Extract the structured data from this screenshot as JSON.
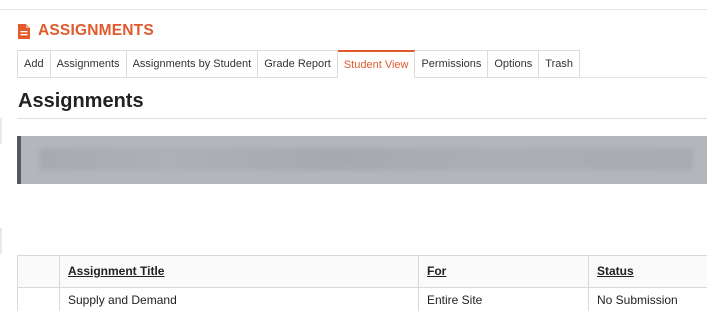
{
  "tool": {
    "title": "ASSIGNMENTS",
    "accent_color": "#e05a2b",
    "icon": "document-icon"
  },
  "nav": {
    "items": [
      {
        "label": "Add"
      },
      {
        "label": "Assignments"
      },
      {
        "label": "Assignments by Student"
      },
      {
        "label": "Grade Report"
      },
      {
        "label": "Student View",
        "active": true
      },
      {
        "label": "Permissions"
      },
      {
        "label": "Options"
      },
      {
        "label": "Trash"
      }
    ]
  },
  "page": {
    "title": "Assignments"
  },
  "table": {
    "headers": [
      "Assignment Title",
      "For",
      "Status"
    ],
    "rows": [
      [
        "Supply and Demand",
        "Entire Site",
        "No Submission"
      ]
    ]
  }
}
